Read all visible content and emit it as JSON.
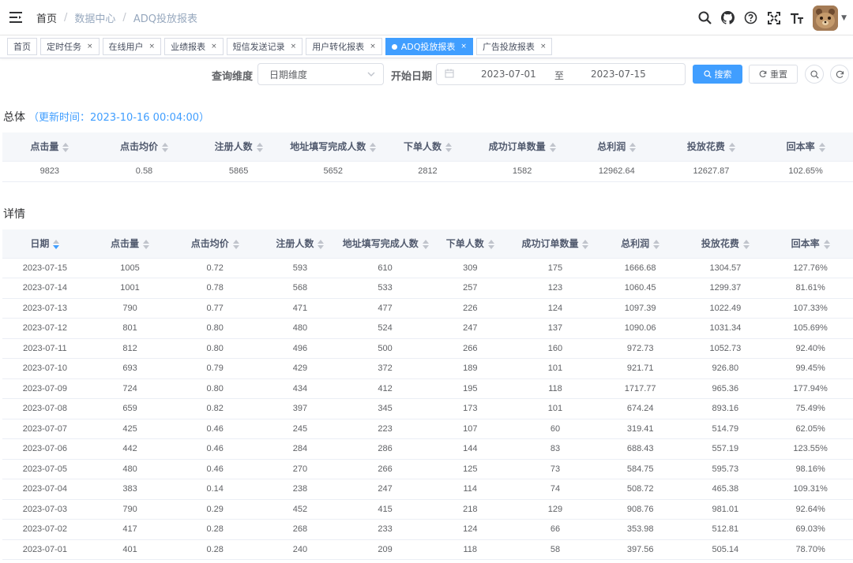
{
  "breadcrumb": [
    "首页",
    "数据中心",
    "ADQ投放报表"
  ],
  "tags": [
    {
      "label": "首页",
      "closable": false,
      "active": false
    },
    {
      "label": "定时任务",
      "closable": true,
      "active": false
    },
    {
      "label": "在线用户",
      "closable": true,
      "active": false
    },
    {
      "label": "业绩报表",
      "closable": true,
      "active": false
    },
    {
      "label": "短信发送记录",
      "closable": true,
      "active": false
    },
    {
      "label": "用户转化报表",
      "closable": true,
      "active": false
    },
    {
      "label": "ADQ投放报表",
      "closable": true,
      "active": true
    },
    {
      "label": "广告投放报表",
      "closable": true,
      "active": false
    }
  ],
  "filters": {
    "dimension_label": "查询维度",
    "dimension_value": "日期维度",
    "start_date_label": "开始日期",
    "start_date": "2023-07-01",
    "range_sep": "至",
    "end_date": "2023-07-15",
    "search_label": "搜索",
    "reset_label": "重置"
  },
  "summary": {
    "title": "总体",
    "update_time": "（更新时间：2023-10-16 00:04:00）",
    "columns": [
      "点击量",
      "点击均价",
      "注册人数",
      "地址填写完成人数",
      "下单人数",
      "成功订单数量",
      "总利润",
      "投放花费",
      "回本率"
    ],
    "row": [
      "9823",
      "0.58",
      "5865",
      "5652",
      "2812",
      "1582",
      "12962.64",
      "12627.87",
      "102.65%"
    ]
  },
  "detail": {
    "title": "详情",
    "columns": [
      "日期",
      "点击量",
      "点击均价",
      "注册人数",
      "地址填写完成人数",
      "下单人数",
      "成功订单数量",
      "总利润",
      "投放花费",
      "回本率"
    ],
    "rows": [
      [
        "2023-07-15",
        "1005",
        "0.72",
        "593",
        "610",
        "309",
        "175",
        "1666.68",
        "1304.57",
        "127.76%"
      ],
      [
        "2023-07-14",
        "1001",
        "0.78",
        "568",
        "533",
        "257",
        "123",
        "1060.45",
        "1299.37",
        "81.61%"
      ],
      [
        "2023-07-13",
        "790",
        "0.77",
        "471",
        "477",
        "226",
        "124",
        "1097.39",
        "1022.49",
        "107.33%"
      ],
      [
        "2023-07-12",
        "801",
        "0.80",
        "480",
        "524",
        "247",
        "137",
        "1090.06",
        "1031.34",
        "105.69%"
      ],
      [
        "2023-07-11",
        "812",
        "0.80",
        "496",
        "500",
        "266",
        "160",
        "972.73",
        "1052.73",
        "92.40%"
      ],
      [
        "2023-07-10",
        "693",
        "0.79",
        "429",
        "372",
        "189",
        "101",
        "921.71",
        "926.80",
        "99.45%"
      ],
      [
        "2023-07-09",
        "724",
        "0.80",
        "434",
        "412",
        "195",
        "118",
        "1717.77",
        "965.36",
        "177.94%"
      ],
      [
        "2023-07-08",
        "659",
        "0.82",
        "397",
        "345",
        "173",
        "101",
        "674.24",
        "893.16",
        "75.49%"
      ],
      [
        "2023-07-07",
        "425",
        "0.46",
        "245",
        "223",
        "107",
        "60",
        "319.41",
        "514.79",
        "62.05%"
      ],
      [
        "2023-07-06",
        "442",
        "0.46",
        "284",
        "286",
        "144",
        "83",
        "688.43",
        "557.19",
        "123.55%"
      ],
      [
        "2023-07-05",
        "480",
        "0.46",
        "270",
        "266",
        "125",
        "73",
        "584.75",
        "595.73",
        "98.16%"
      ],
      [
        "2023-07-04",
        "383",
        "0.14",
        "238",
        "247",
        "114",
        "74",
        "508.72",
        "465.38",
        "109.31%"
      ],
      [
        "2023-07-03",
        "790",
        "0.29",
        "452",
        "415",
        "218",
        "129",
        "908.76",
        "981.01",
        "92.64%"
      ],
      [
        "2023-07-02",
        "417",
        "0.28",
        "268",
        "233",
        "124",
        "66",
        "353.98",
        "512.81",
        "69.03%"
      ],
      [
        "2023-07-01",
        "401",
        "0.28",
        "240",
        "209",
        "118",
        "58",
        "397.56",
        "505.14",
        "78.70%"
      ]
    ]
  },
  "colors": {
    "primary": "#409eff",
    "header_bg": "#f5f7fa",
    "border": "#ebeef5"
  }
}
